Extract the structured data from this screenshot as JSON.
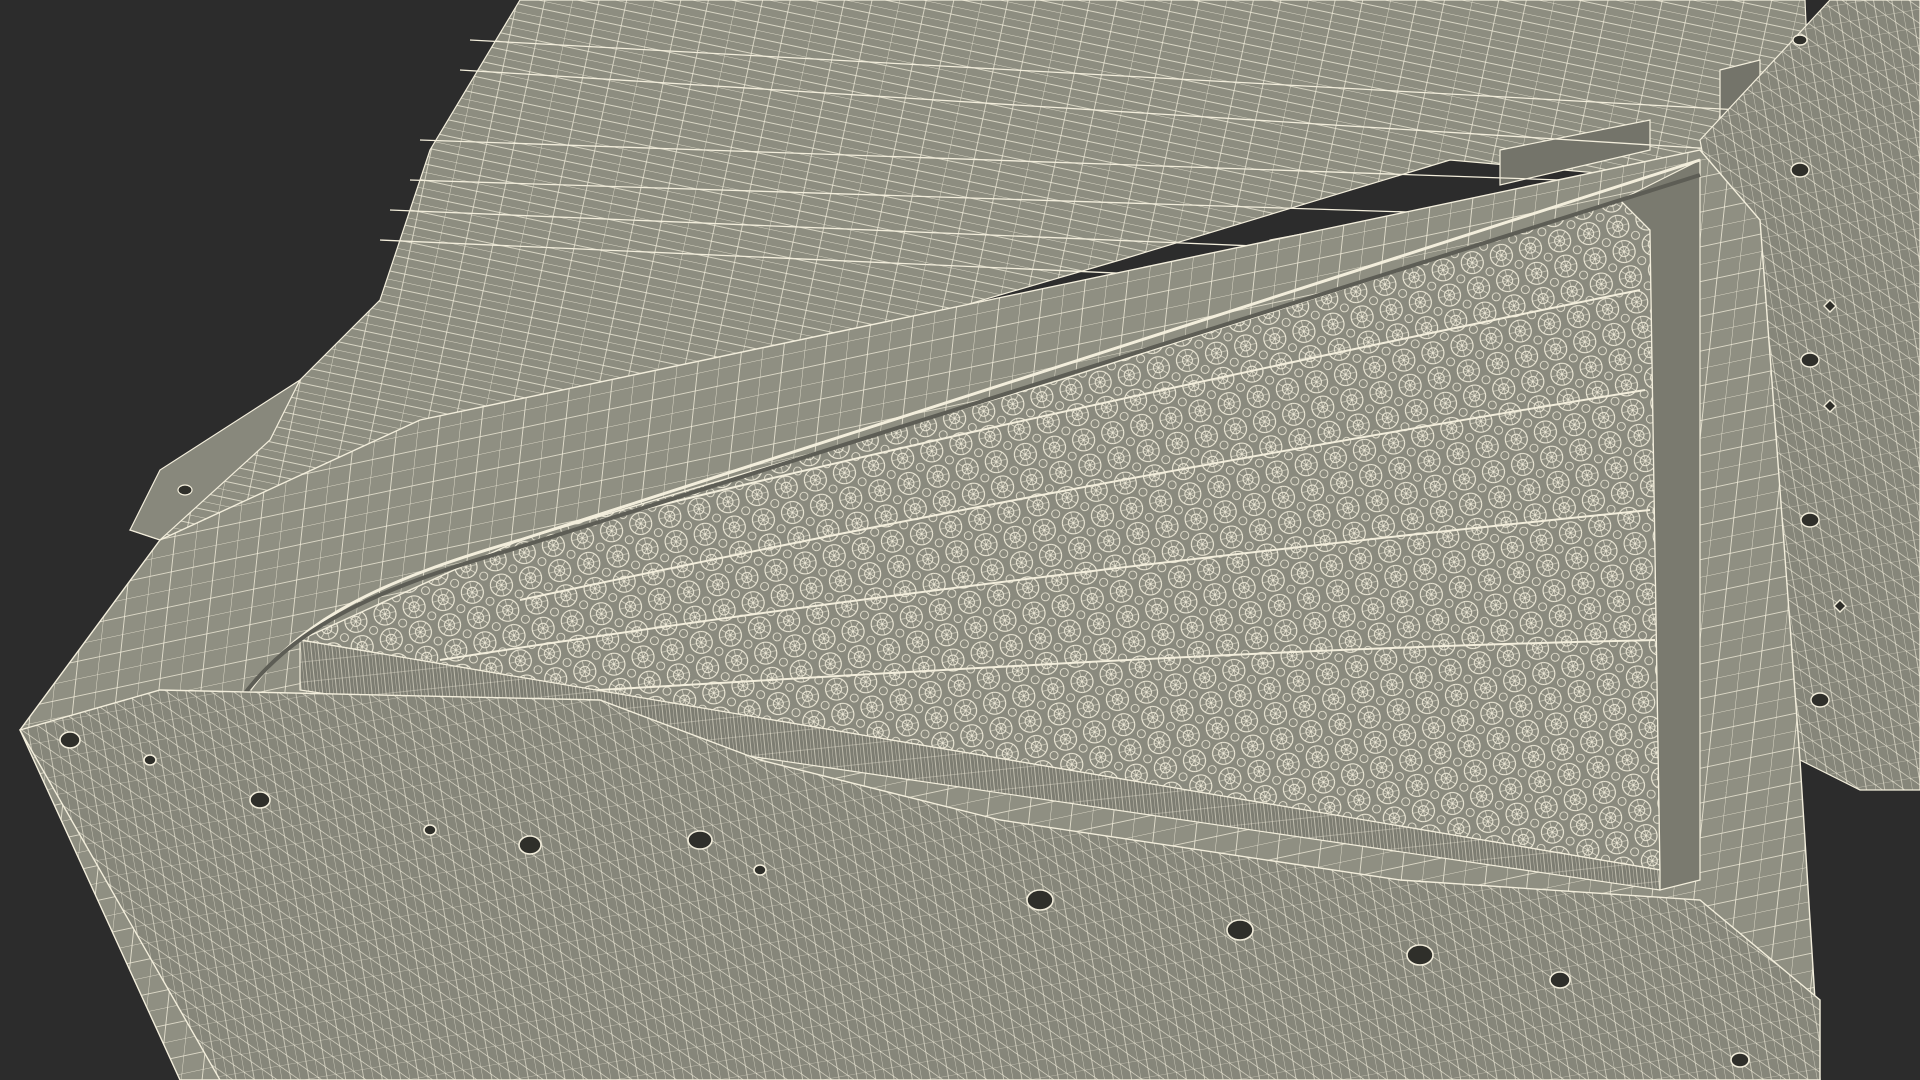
{
  "scene": {
    "subject": "",
    "background_color": "#2c2c2c",
    "surface_color": "#8f8f82",
    "surface_dark": "#74746a",
    "wire_color": "#f3eedc",
    "shadow_color": "#5d5d55"
  }
}
